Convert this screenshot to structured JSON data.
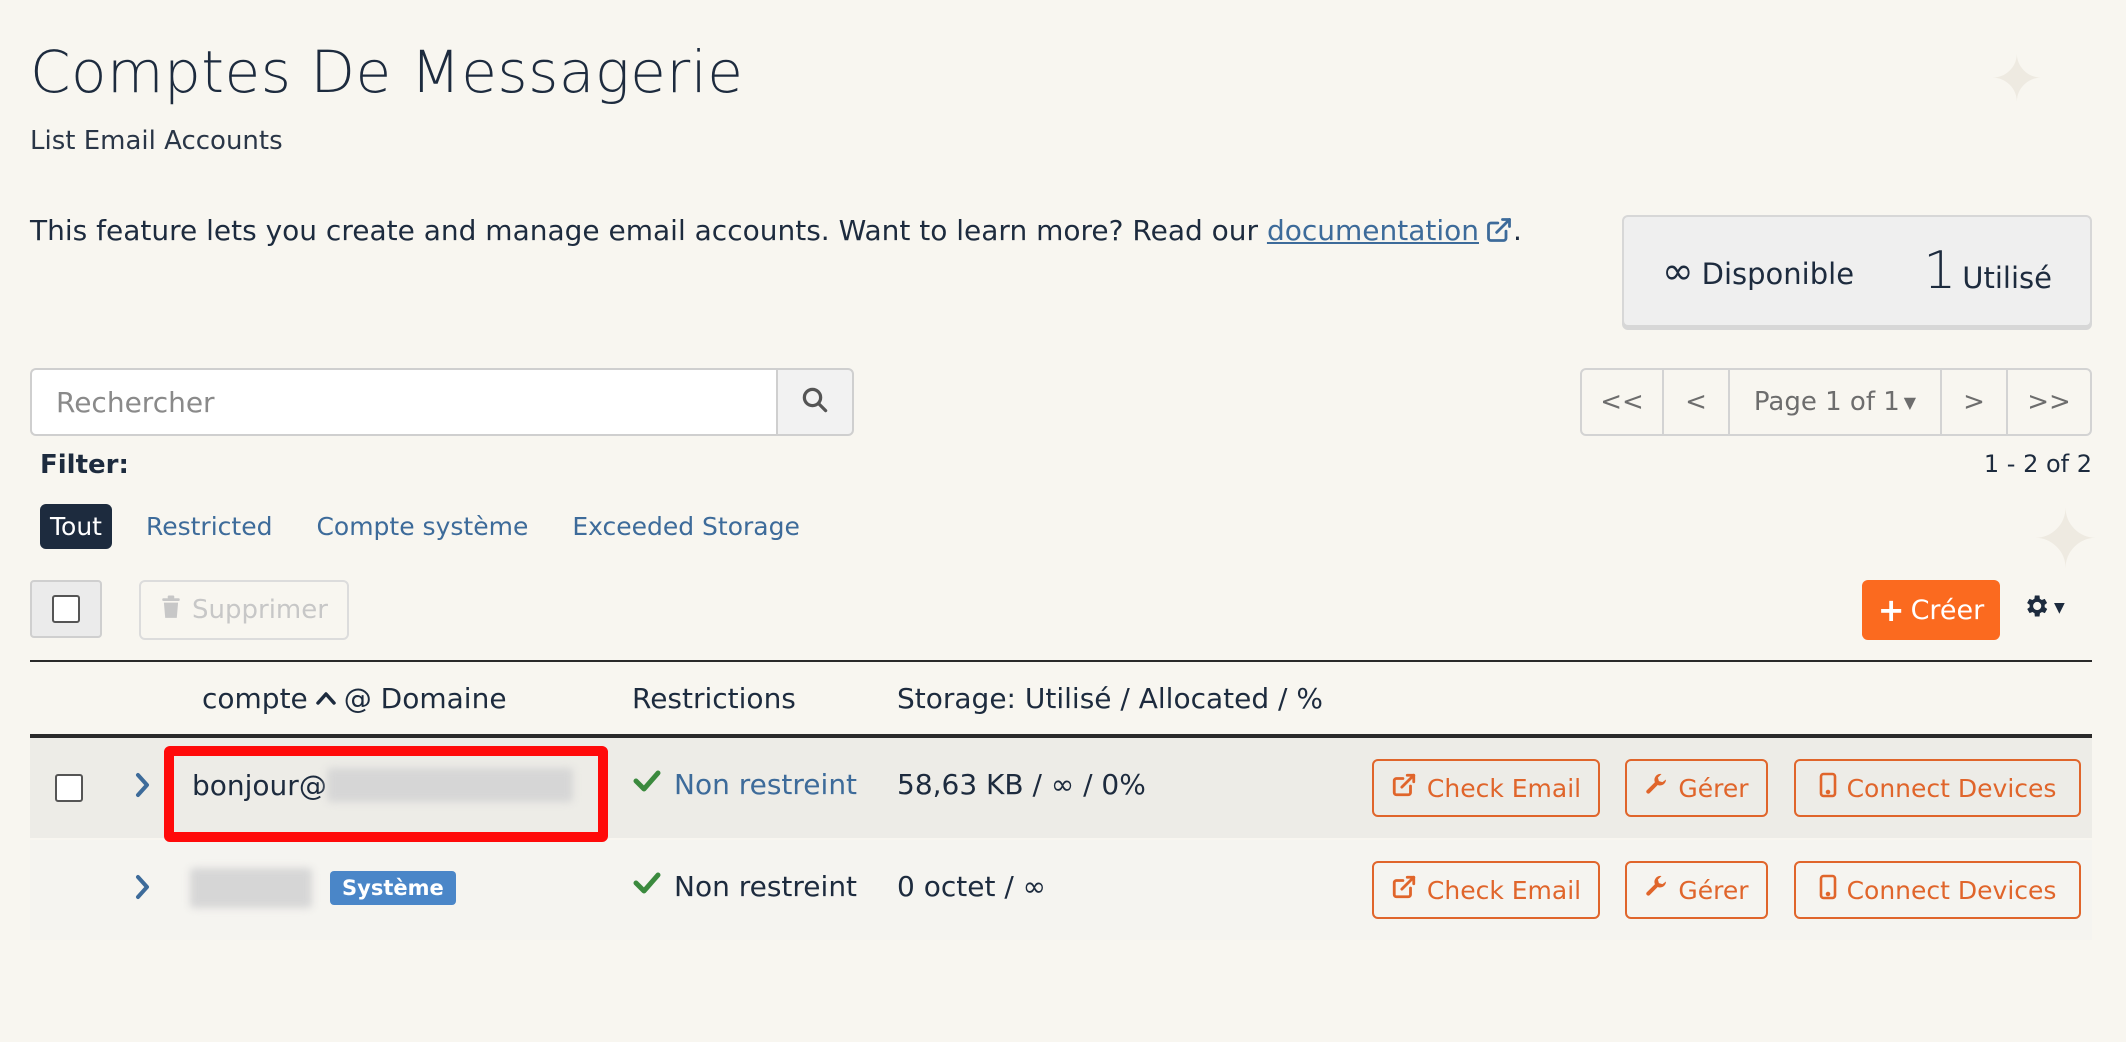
{
  "header": {
    "title": "Comptes De Messagerie",
    "subtitle": "List Email Accounts"
  },
  "intro": {
    "text_before": "This feature lets you create and manage email accounts. Want to learn more? Read our ",
    "link_label": "documentation",
    "text_after": "."
  },
  "stats": {
    "available_value": "∞",
    "available_label": "Disponible",
    "used_value": "1",
    "used_label": "Utilisé"
  },
  "search": {
    "placeholder": "Rechercher",
    "value": ""
  },
  "pagination": {
    "first": "<<",
    "prev": "<",
    "page_label": "Page 1 of 1",
    "next": ">",
    "last": ">>",
    "count": "1 - 2 of 2"
  },
  "filter": {
    "label": "Filter:",
    "chips": [
      "Tout",
      "Restricted",
      "Compte système",
      "Exceeded Storage"
    ],
    "active": "Tout"
  },
  "toolbar": {
    "delete_label": "Supprimer",
    "create_label": "Créer"
  },
  "table": {
    "columns": {
      "account_prefix": "compte",
      "account_suffix": "@ Domaine",
      "restrictions": "Restrictions",
      "storage": "Storage: Utilisé / Allocated / %"
    },
    "rows": [
      {
        "account": "bonjour@",
        "badge": "",
        "restriction": "Non restreint",
        "storage": "58,63 KB / ∞ / 0%"
      },
      {
        "account": "",
        "badge": "Système",
        "restriction": "Non restreint",
        "storage": "0 octet / ∞"
      }
    ],
    "actions": {
      "check_email": "Check Email",
      "manage": "Gérer",
      "connect_devices": "Connect Devices"
    }
  },
  "colors": {
    "accent": "#fb6a1f",
    "action_outline": "#e0652b",
    "link": "#3d6b9a",
    "badge": "#4a86c8",
    "highlight": "#ff0a0a",
    "check": "#3b8a3e"
  }
}
